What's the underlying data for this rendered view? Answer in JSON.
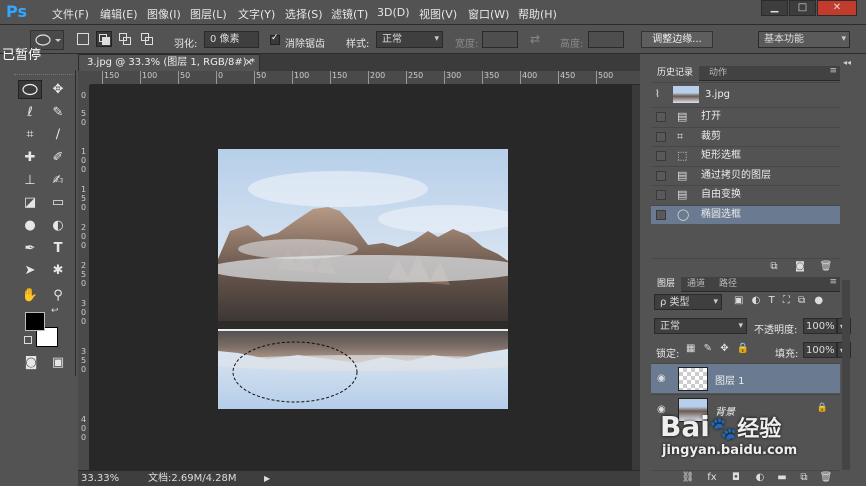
{
  "app": {
    "logo": "Ps"
  },
  "menu": [
    "文件(F)",
    "编辑(E)",
    "图像(I)",
    "图层(L)",
    "文字(Y)",
    "选择(S)",
    "滤镜(T)",
    "3D(D)",
    "视图(V)",
    "窗口(W)",
    "帮助(H)"
  ],
  "window_controls": {
    "minimize": "▁",
    "restore": "□",
    "close": "✕"
  },
  "options": {
    "feather_label": "羽化:",
    "feather_value": "0 像素",
    "antialias_label": "消除锯齿",
    "style_label": "样式:",
    "style_value": "正常",
    "width_label": "宽度:",
    "height_label": "高度:",
    "refine_edge_label": "调整边缘...",
    "workspace_value": "基本功能"
  },
  "overlay": {
    "paused": "已暂停"
  },
  "document": {
    "tab_title": "3.jpg @ 33.3% (图层 1, RGB/8#) *",
    "tab_close": "×",
    "ruler_h": [
      "150",
      "100",
      "50",
      "0",
      "50",
      "100",
      "150",
      "200",
      "250",
      "300",
      "350",
      "400",
      "450",
      "500"
    ],
    "ruler_v": [
      "0",
      "5",
      "0",
      "1",
      "0",
      "0",
      "1",
      "5",
      "0",
      "2",
      "0",
      "0",
      "2",
      "5",
      "0",
      "3",
      "0",
      "0",
      "3",
      "5",
      "0",
      "4",
      "0",
      "0"
    ],
    "zoom": "33.33%",
    "doc_info": "文档:2.69M/4.28M"
  },
  "history": {
    "tabs": [
      "历史记录",
      "动作"
    ],
    "snapshot": "3.jpg",
    "items": [
      {
        "icon": "document-icon",
        "label": "打开"
      },
      {
        "icon": "crop-icon",
        "label": "裁剪"
      },
      {
        "icon": "marquee-icon",
        "label": "矩形选框"
      },
      {
        "icon": "document-icon",
        "label": "通过拷贝的图层"
      },
      {
        "icon": "document-icon",
        "label": "自由变换"
      },
      {
        "icon": "ellipse-icon",
        "label": "椭圆选框"
      }
    ]
  },
  "layers": {
    "tabs": [
      "图层",
      "通道",
      "路径"
    ],
    "filter_value": "ρ 类型",
    "blend_mode": "正常",
    "opacity_label": "不透明度:",
    "opacity_value": "100%",
    "lock_label": "锁定:",
    "fill_label": "填充:",
    "fill_value": "100%",
    "items": [
      {
        "name": "图层 1",
        "selected": true
      },
      {
        "name": "背景",
        "selected": false
      }
    ]
  },
  "watermark": {
    "brand": "Bai",
    "paw": "🐾",
    "suffix": "经验",
    "url": "jingyan.baidu.com"
  }
}
